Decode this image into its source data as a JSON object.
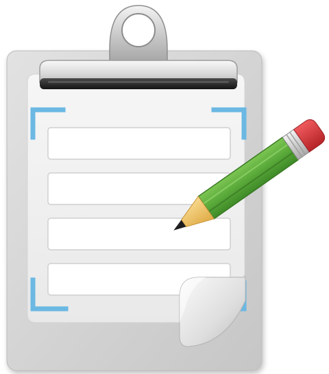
{
  "icon": {
    "name": "clipboard-form-edit-icon",
    "parts": [
      "clipboard-board",
      "clip-ring",
      "clip-bar",
      "form-field",
      "corner-bracket",
      "page-curl",
      "pencil-icon"
    ]
  },
  "form": {
    "field_count": 4
  },
  "colors": {
    "board": "#d6d6d6",
    "board_shadow": "#b8b8b8",
    "paper": "#f1f1f1",
    "field_fill": "#ffffff",
    "field_border": "#d0d0d0",
    "bracket": "#6bb8e3",
    "clip_metal": "#b9b9b9",
    "clip_bar": "#2e2e2e",
    "pencil_body": "#5aaa3a",
    "pencil_body_dark": "#3f8a28",
    "pencil_wood": "#f3c86f",
    "pencil_eraser": "#d9363a",
    "pencil_ferrule": "#d8d8d8",
    "pencil_tip": "#1e1e1e"
  }
}
